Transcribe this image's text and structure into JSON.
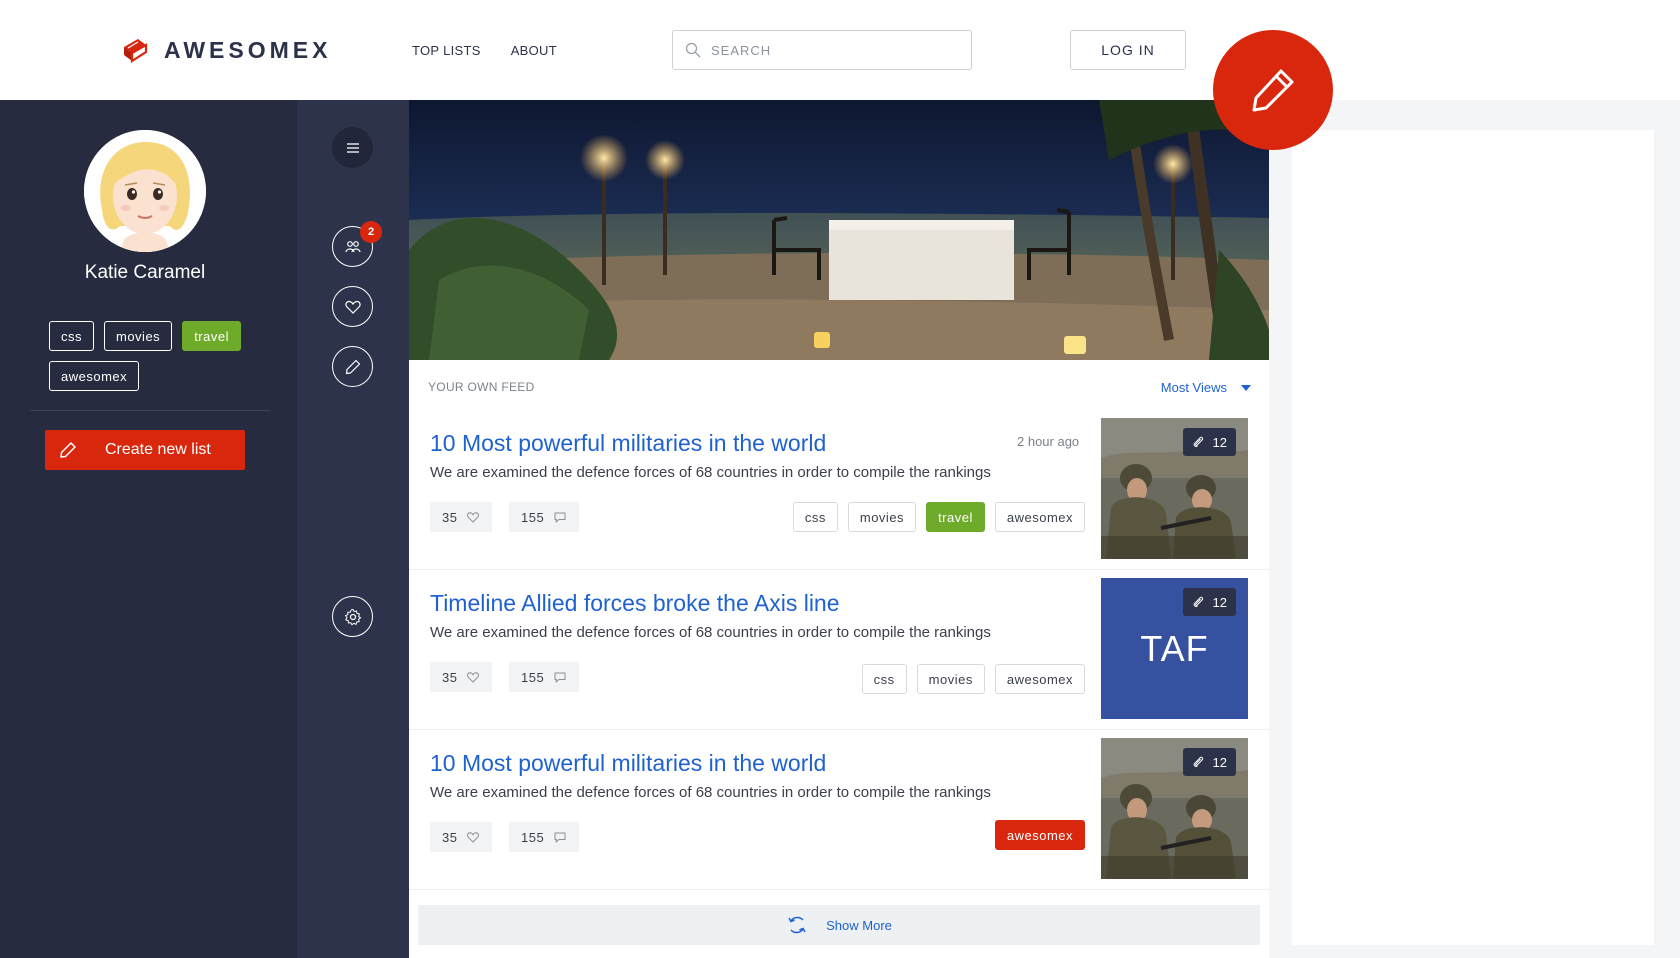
{
  "app": {
    "brand": "AWESOMEX"
  },
  "nav": {
    "top_lists": "TOP LISTS",
    "about": "ABOUT"
  },
  "search": {
    "placeholder": "SEARCH"
  },
  "login": {
    "label": "LOG IN"
  },
  "profile": {
    "name": "Katie Caramel",
    "tags": [
      {
        "label": "css",
        "active": false
      },
      {
        "label": "movies",
        "active": false
      },
      {
        "label": "travel",
        "active": true
      },
      {
        "label": "awesomex",
        "active": false
      }
    ],
    "create_label": "Create new list"
  },
  "rail": {
    "friends_badge": "2"
  },
  "feed": {
    "heading": "YOUR OWN FEED",
    "sort_label": "Most Views",
    "posts": [
      {
        "title": "10 Most powerful militaries in the world",
        "time": "2 hour ago",
        "desc": "We are examined the defence forces of 68 countries in order to compile the rankings",
        "likes": "35",
        "comments": "155",
        "tags": [
          "css",
          "movies",
          "travel",
          "awesomex"
        ],
        "attachments": "12"
      },
      {
        "title": "Timeline Allied forces broke the Axis line",
        "desc": "We are examined the defence forces of 68 countries in order to compile the rankings",
        "likes": "35",
        "comments": "155",
        "tags": [
          "css",
          "movies",
          "awesomex"
        ],
        "attachments": "12",
        "thumb_text": "TAF"
      },
      {
        "title": "10 Most powerful militaries in the world",
        "desc": "We are examined the defence forces of 68 countries in order to compile the rankings",
        "likes": "35",
        "comments": "155",
        "tags": [
          "awesomex"
        ],
        "attachments": "12"
      }
    ],
    "show_more": "Show More"
  },
  "colors": {
    "accent_red": "#d8270c",
    "link_blue": "#1f62cf",
    "tag_green": "#6fab2a",
    "sidebar_dark": "#262b3f",
    "rail_dark": "#2d334b",
    "thumb_blue": "#35519f"
  },
  "icons": {
    "logo": "book-icon",
    "search": "search-icon",
    "fab": "pencil-icon",
    "menu": "menu-icon",
    "friends": "users-icon",
    "favorites": "heart-icon",
    "edit": "pencil-icon",
    "settings": "gear-icon",
    "like": "heart-icon",
    "comment": "comment-icon",
    "attachment": "paperclip-icon",
    "refresh": "refresh-icon"
  }
}
